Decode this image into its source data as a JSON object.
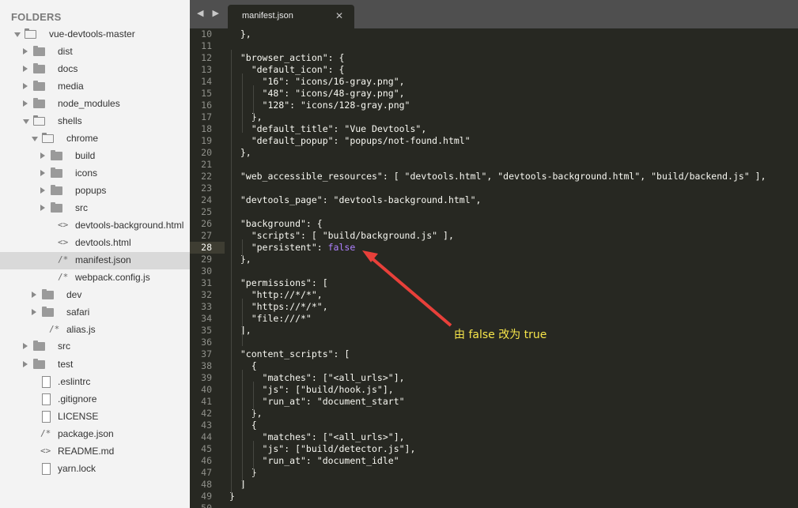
{
  "sidebar": {
    "title": "FOLDERS",
    "items": [
      {
        "label": "vue-devtools-master",
        "type": "folder",
        "depth": 0,
        "expanded": true
      },
      {
        "label": "dist",
        "type": "folder",
        "depth": 1,
        "expanded": false
      },
      {
        "label": "docs",
        "type": "folder",
        "depth": 1,
        "expanded": false
      },
      {
        "label": "media",
        "type": "folder",
        "depth": 1,
        "expanded": false
      },
      {
        "label": "node_modules",
        "type": "folder",
        "depth": 1,
        "expanded": false
      },
      {
        "label": "shells",
        "type": "folder",
        "depth": 1,
        "expanded": true
      },
      {
        "label": "chrome",
        "type": "folder",
        "depth": 2,
        "expanded": true
      },
      {
        "label": "build",
        "type": "folder",
        "depth": 3,
        "expanded": false
      },
      {
        "label": "icons",
        "type": "folder",
        "depth": 3,
        "expanded": false
      },
      {
        "label": "popups",
        "type": "folder",
        "depth": 3,
        "expanded": false
      },
      {
        "label": "src",
        "type": "folder",
        "depth": 3,
        "expanded": false
      },
      {
        "label": "devtools-background.html",
        "type": "code",
        "depth": 3
      },
      {
        "label": "devtools.html",
        "type": "code",
        "depth": 3
      },
      {
        "label": "manifest.json",
        "type": "comment",
        "depth": 3,
        "selected": true
      },
      {
        "label": "webpack.config.js",
        "type": "comment",
        "depth": 3
      },
      {
        "label": "dev",
        "type": "folder",
        "depth": 2,
        "expanded": false
      },
      {
        "label": "safari",
        "type": "folder",
        "depth": 2,
        "expanded": false
      },
      {
        "label": "alias.js",
        "type": "comment",
        "depth": 2
      },
      {
        "label": "src",
        "type": "folder",
        "depth": 1,
        "expanded": false
      },
      {
        "label": "test",
        "type": "folder",
        "depth": 1,
        "expanded": false
      },
      {
        "label": ".eslintrc",
        "type": "file",
        "depth": 1
      },
      {
        "label": ".gitignore",
        "type": "file",
        "depth": 1
      },
      {
        "label": "LICENSE",
        "type": "file",
        "depth": 1
      },
      {
        "label": "package.json",
        "type": "comment",
        "depth": 1
      },
      {
        "label": "README.md",
        "type": "code",
        "depth": 1
      },
      {
        "label": "yarn.lock",
        "type": "file",
        "depth": 1
      }
    ]
  },
  "tabbar": {
    "nav_arrows": "◀ ▶",
    "active_tab": "manifest.json",
    "close_glyph": "✕"
  },
  "editor": {
    "first_line_number": 10,
    "active_line": 28,
    "lines": [
      "  },",
      "",
      "  \"browser_action\": {",
      "    \"default_icon\": {",
      "      \"16\": \"icons/16-gray.png\",",
      "      \"48\": \"icons/48-gray.png\",",
      "      \"128\": \"icons/128-gray.png\"",
      "    },",
      "    \"default_title\": \"Vue Devtools\",",
      "    \"default_popup\": \"popups/not-found.html\"",
      "  },",
      "",
      "  \"web_accessible_resources\": [ \"devtools.html\", \"devtools-background.html\", \"build/backend.js\" ],",
      "",
      "  \"devtools_page\": \"devtools-background.html\",",
      "",
      "  \"background\": {",
      "    \"scripts\": [ \"build/background.js\" ],",
      "    \"persistent\": false",
      "  },",
      "",
      "  \"permissions\": [",
      "    \"http://*/*\",",
      "    \"https://*/*\",",
      "    \"file:///*\"",
      "  ],",
      "",
      "  \"content_scripts\": [",
      "    {",
      "      \"matches\": [\"<all_urls>\"],",
      "      \"js\": [\"build/hook.js\"],",
      "      \"run_at\": \"document_start\"",
      "    },",
      "    {",
      "      \"matches\": [\"<all_urls>\"],",
      "      \"js\": [\"build/detector.js\"],",
      "      \"run_at\": \"document_idle\"",
      "    }",
      "  ]",
      "}",
      ""
    ],
    "keyword_highlight": "false",
    "colors": {
      "background": "#272822",
      "text": "#f8f8f2",
      "keyword": "#ae81ff",
      "gutter": "#8f908a"
    }
  },
  "annotation": {
    "text": "由 false 改为 true",
    "color": "#f6e54a",
    "arrow_color": "#e8403a"
  }
}
